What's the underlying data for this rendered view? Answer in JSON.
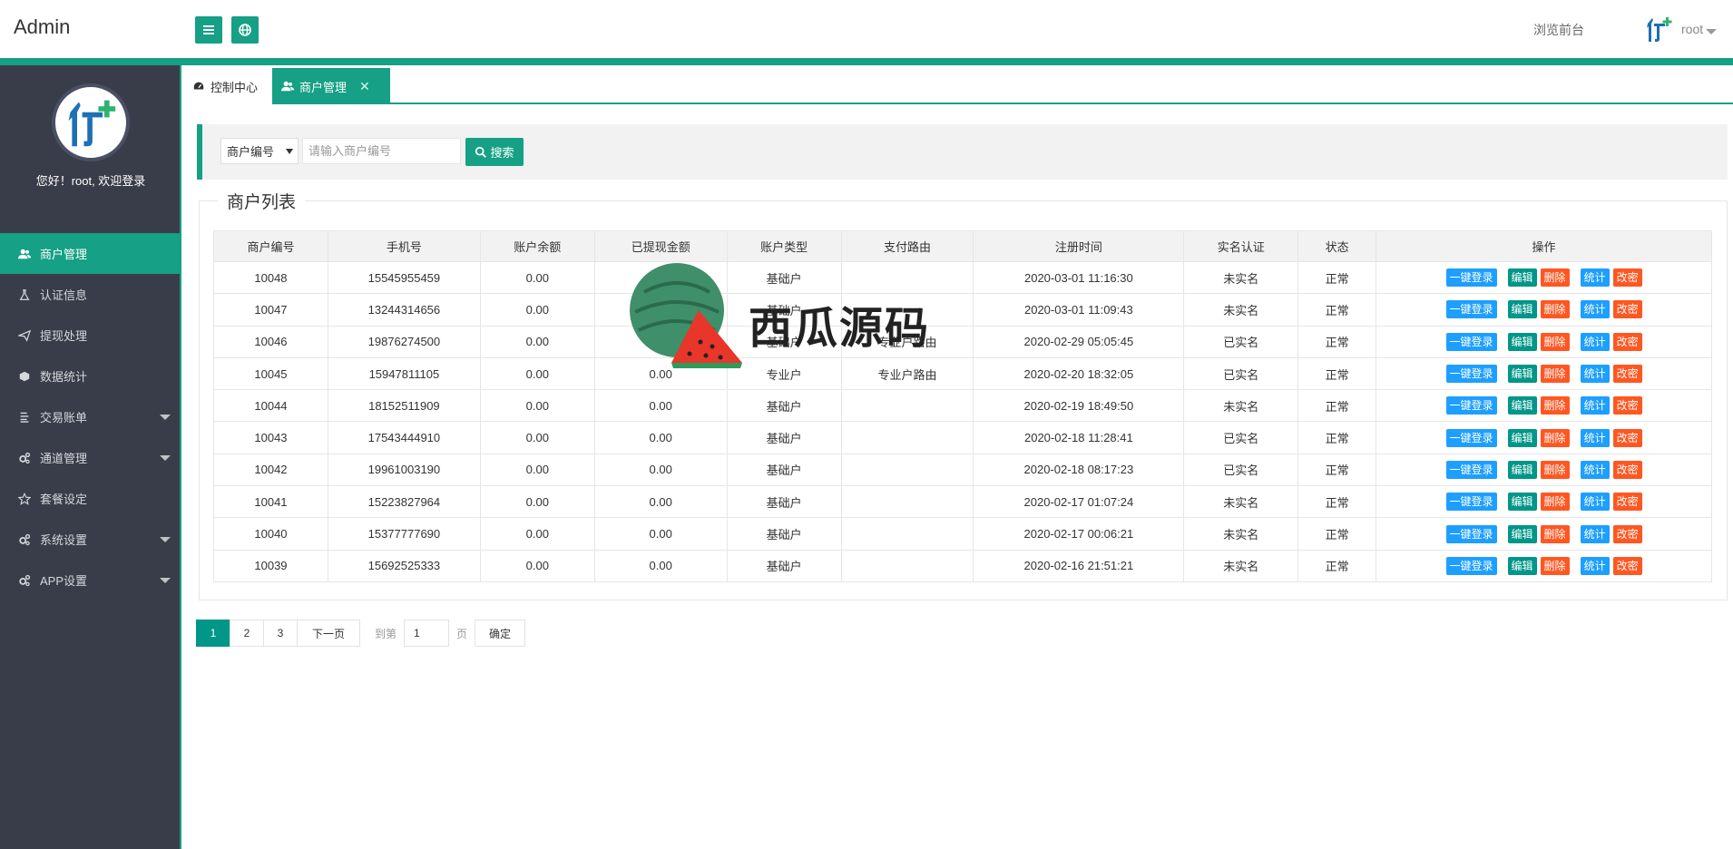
{
  "header": {
    "app_title": "Admin",
    "front_link": "浏览前台",
    "user_name": "root"
  },
  "sidebar": {
    "welcome": "您好！root, 欢迎登录",
    "items": [
      {
        "label": "商户管理",
        "icon": "users-icon",
        "active": true,
        "has_caret": false
      },
      {
        "label": "认证信息",
        "icon": "flask-icon",
        "active": false,
        "has_caret": false
      },
      {
        "label": "提现处理",
        "icon": "send-icon",
        "active": false,
        "has_caret": false
      },
      {
        "label": "数据统计",
        "icon": "cube-icon",
        "active": false,
        "has_caret": false
      },
      {
        "label": "交易账单",
        "icon": "list-icon",
        "active": false,
        "has_caret": true
      },
      {
        "label": "通道管理",
        "icon": "gears-icon",
        "active": false,
        "has_caret": true
      },
      {
        "label": "套餐设定",
        "icon": "star-icon",
        "active": false,
        "has_caret": false
      },
      {
        "label": "系统设置",
        "icon": "gears-icon",
        "active": false,
        "has_caret": true
      },
      {
        "label": "APP设置",
        "icon": "gears-icon",
        "active": false,
        "has_caret": true
      }
    ]
  },
  "tabs": [
    {
      "label": "控制中心"
    },
    {
      "label": "商户管理"
    }
  ],
  "search": {
    "select_value": "商户编号",
    "placeholder": "请输入商户编号",
    "button_label": "搜索"
  },
  "list": {
    "legend": "商户列表",
    "columns": [
      "商户编号",
      "手机号",
      "账户余额",
      "已提现金额",
      "账户类型",
      "支付路由",
      "注册时间",
      "实名认证",
      "状态",
      "操作"
    ],
    "rows": [
      {
        "id": "10048",
        "phone": "15545955459",
        "balance": "0.00",
        "withdrawn": "0.00",
        "type": "基础户",
        "route": "",
        "time": "2020-03-01 11:16:30",
        "auth": "未实名",
        "auth_ok": false,
        "status": "正常"
      },
      {
        "id": "10047",
        "phone": "13244314656",
        "balance": "0.00",
        "withdrawn": "0.00",
        "type": "基础户",
        "route": "",
        "time": "2020-03-01 11:09:43",
        "auth": "未实名",
        "auth_ok": false,
        "status": "正常"
      },
      {
        "id": "10046",
        "phone": "19876274500",
        "balance": "0.00",
        "withdrawn": "0.00",
        "type": "基础户",
        "route": "专业户路由",
        "time": "2020-02-29 05:05:45",
        "auth": "已实名",
        "auth_ok": true,
        "status": "正常"
      },
      {
        "id": "10045",
        "phone": "15947811105",
        "balance": "0.00",
        "withdrawn": "0.00",
        "type": "专业户",
        "route": "专业户路由",
        "time": "2020-02-20 18:32:05",
        "auth": "已实名",
        "auth_ok": true,
        "status": "正常"
      },
      {
        "id": "10044",
        "phone": "18152511909",
        "balance": "0.00",
        "withdrawn": "0.00",
        "type": "基础户",
        "route": "",
        "time": "2020-02-19 18:49:50",
        "auth": "未实名",
        "auth_ok": false,
        "status": "正常"
      },
      {
        "id": "10043",
        "phone": "17543444910",
        "balance": "0.00",
        "withdrawn": "0.00",
        "type": "基础户",
        "route": "",
        "time": "2020-02-18 11:28:41",
        "auth": "已实名",
        "auth_ok": true,
        "status": "正常"
      },
      {
        "id": "10042",
        "phone": "19961003190",
        "balance": "0.00",
        "withdrawn": "0.00",
        "type": "基础户",
        "route": "",
        "time": "2020-02-18 08:17:23",
        "auth": "已实名",
        "auth_ok": true,
        "status": "正常"
      },
      {
        "id": "10041",
        "phone": "15223827964",
        "balance": "0.00",
        "withdrawn": "0.00",
        "type": "基础户",
        "route": "",
        "time": "2020-02-17 01:07:24",
        "auth": "未实名",
        "auth_ok": false,
        "status": "正常"
      },
      {
        "id": "10040",
        "phone": "15377777690",
        "balance": "0.00",
        "withdrawn": "0.00",
        "type": "基础户",
        "route": "",
        "time": "2020-02-17 00:06:21",
        "auth": "未实名",
        "auth_ok": false,
        "status": "正常"
      },
      {
        "id": "10039",
        "phone": "15692525333",
        "balance": "0.00",
        "withdrawn": "0.00",
        "type": "基础户",
        "route": "",
        "time": "2020-02-16 21:51:21",
        "auth": "未实名",
        "auth_ok": false,
        "status": "正常"
      }
    ],
    "actions": [
      "一键登录",
      "编辑",
      "删除",
      "统计",
      "改密"
    ]
  },
  "pager": {
    "pages": [
      "1",
      "2",
      "3"
    ],
    "current": "1",
    "next": "下一页",
    "goto_prefix": "到第",
    "goto_value": "1",
    "goto_suffix": "页",
    "confirm": "确定"
  },
  "watermark": {
    "text": "西瓜源码"
  },
  "colors": {
    "accent": "#16a085",
    "sidebar_bg": "#393d49",
    "unverified": "#e0245e"
  }
}
